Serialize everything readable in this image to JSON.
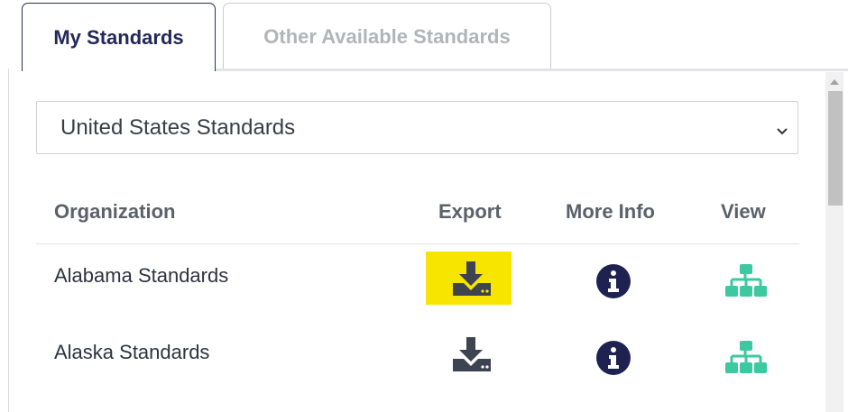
{
  "tabs": [
    {
      "label": "My Standards",
      "active": true
    },
    {
      "label": "Other Available Standards",
      "active": false
    }
  ],
  "select": {
    "value": "United States Standards"
  },
  "table": {
    "headers": {
      "organization": "Organization",
      "export": "Export",
      "more_info": "More Info",
      "view": "View"
    },
    "rows": [
      {
        "organization": "Alabama Standards",
        "export_highlighted": true
      },
      {
        "organization": "Alaska Standards",
        "export_highlighted": false
      }
    ]
  },
  "icons": {
    "export": "download-icon",
    "more_info": "info-circle-icon",
    "view": "sitemap-icon"
  },
  "colors": {
    "active_tab_text": "#24285a",
    "inactive_tab_text": "#b2b4b9",
    "header_text": "#5b616b",
    "export_icon": "#3d4350",
    "info_icon": "#1e2250",
    "view_icon": "#3cc8a0",
    "highlight": "#f7e500"
  }
}
